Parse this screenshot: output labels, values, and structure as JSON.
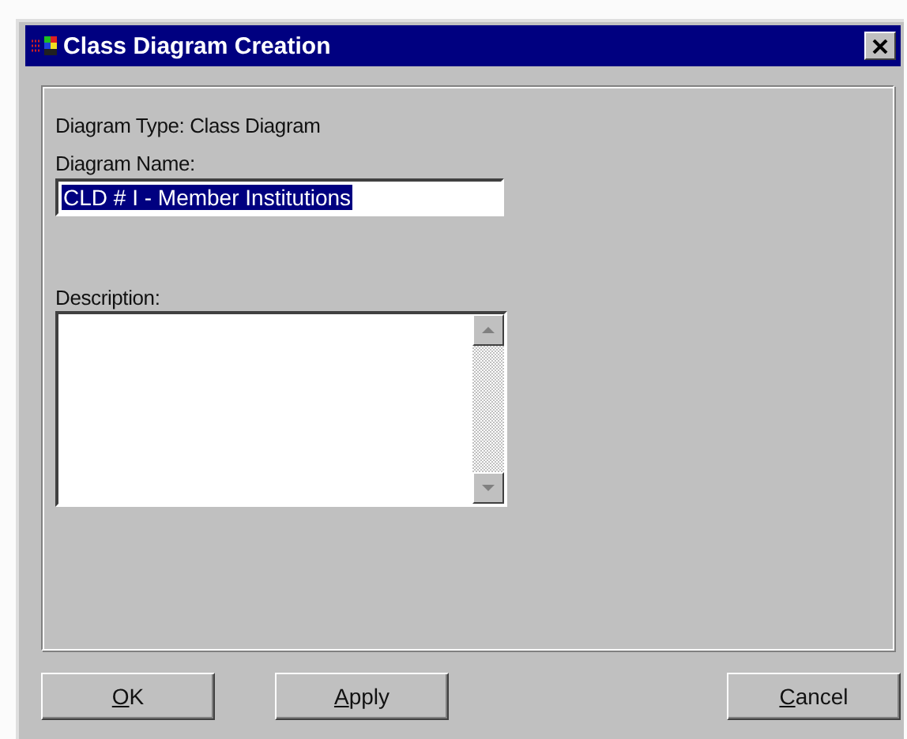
{
  "window": {
    "title": "Class Diagram Creation"
  },
  "diagram_type": {
    "label": "Diagram Type: Class Diagram"
  },
  "name_field": {
    "label": "Diagram Name:",
    "value": "CLD # I - Member Institutions",
    "selected": true
  },
  "description_field": {
    "label": "Description:"
  },
  "buttons": [
    {
      "label": "OK",
      "first_letter_underlined": true
    },
    {
      "label": "Apply",
      "first_letter_underlined": true
    },
    {
      "label": "Cancel",
      "first_letter_underlined": true
    }
  ]
}
